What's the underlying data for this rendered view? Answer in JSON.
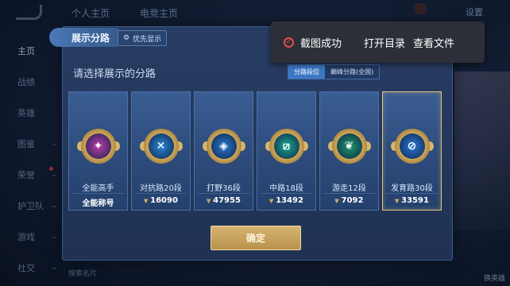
{
  "background": {
    "top_tabs": [
      "个人主页",
      "电竞主页"
    ],
    "settings": "设置",
    "left_nav": [
      {
        "label": "主页",
        "active": true
      },
      {
        "label": "战绩"
      },
      {
        "label": "英雄"
      },
      {
        "label": "图鉴",
        "chevron": true
      },
      {
        "label": "荣誉",
        "chevron": true,
        "dot": true
      },
      {
        "label": "护卫队",
        "chevron": true
      },
      {
        "label": "游戏",
        "chevron": true
      },
      {
        "label": "社交",
        "chevron": true
      }
    ],
    "bottom_search": "搜索名片",
    "right_bottom": "换英雄"
  },
  "panel": {
    "tab_title": "展示分路",
    "priority_button": "优先显示",
    "prompt": "请选择展示的分路",
    "segments": [
      {
        "label": "分路段位",
        "active": true
      },
      {
        "label": "巅峰分路(全国)",
        "active": false
      }
    ],
    "cards": [
      {
        "name": "全能高手",
        "value": "全能称号",
        "glyph": "✦",
        "color": "#c23dae",
        "selected": false,
        "show_chevron": false
      },
      {
        "name": "对抗路20段",
        "value": "16090",
        "glyph": "✕",
        "color": "#2a88d8",
        "selected": false,
        "show_chevron": true
      },
      {
        "name": "打野36段",
        "value": "47955",
        "glyph": "◈",
        "color": "#2a78d0",
        "selected": false,
        "show_chevron": true
      },
      {
        "name": "中路18段",
        "value": "13492",
        "glyph": "⧄",
        "color": "#1aa892",
        "selected": false,
        "show_chevron": true
      },
      {
        "name": "游走12段",
        "value": "7092",
        "glyph": "❦",
        "color": "#1e9a6a",
        "selected": false,
        "show_chevron": true
      },
      {
        "name": "发育路30段",
        "value": "33591",
        "glyph": "⊘",
        "color": "#2a7ad8",
        "selected": true,
        "show_chevron": true
      }
    ],
    "confirm_button": "确定"
  },
  "toast": {
    "message": "截图成功",
    "action_open": "打开目录",
    "action_view": "查看文件"
  }
}
